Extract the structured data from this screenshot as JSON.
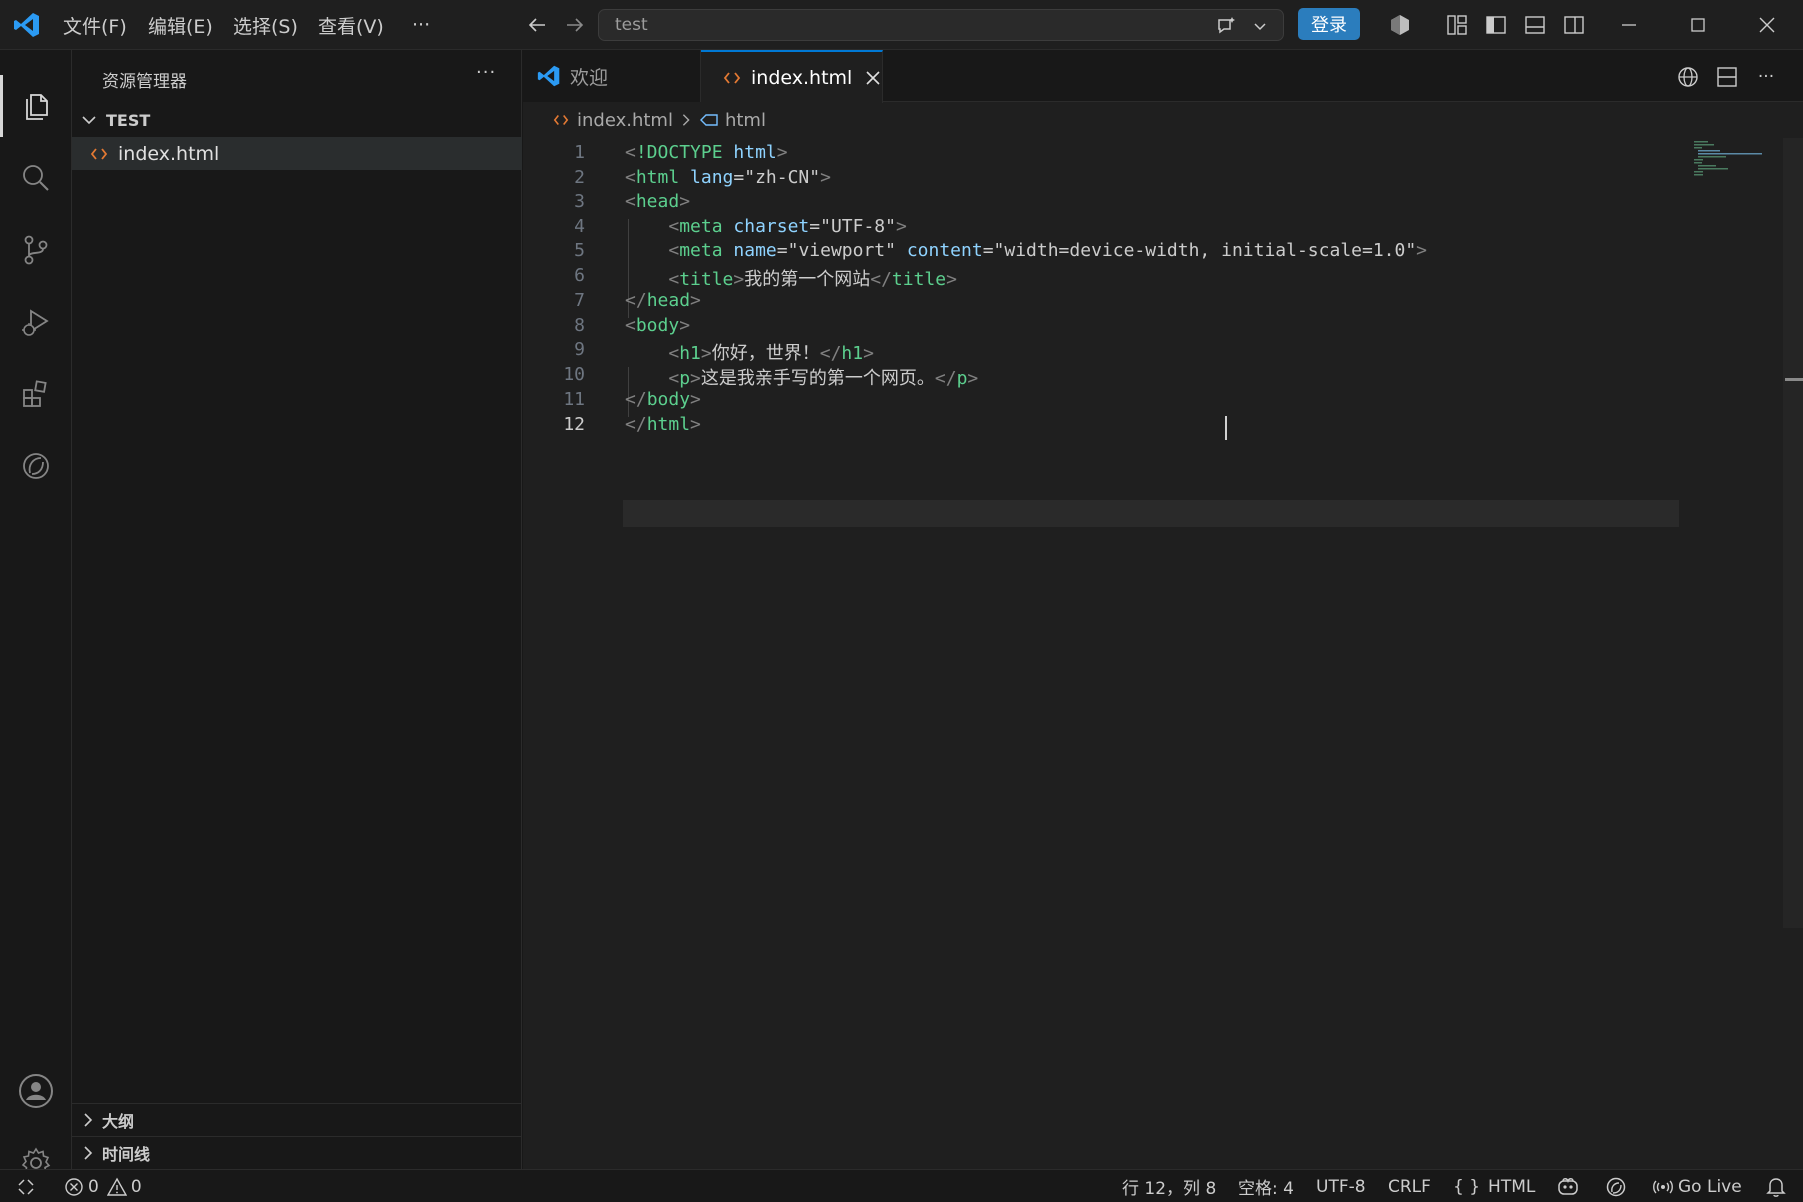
{
  "titlebar": {
    "menus": [
      "文件(F)",
      "编辑(E)",
      "选择(S)",
      "查看(V)"
    ],
    "more": "···",
    "search_text": "test",
    "login_label": "登录"
  },
  "activitybar": {
    "items": [
      "explorer",
      "search",
      "source-control",
      "run-debug",
      "extensions",
      "remote"
    ]
  },
  "sidebar": {
    "title": "资源管理器",
    "more": "···",
    "folder": "TEST",
    "files": [
      "index.html"
    ],
    "sections": [
      "大纲",
      "时间线"
    ]
  },
  "editor": {
    "tabs": [
      {
        "label": "欢迎",
        "active": false
      },
      {
        "label": "index.html",
        "active": true
      }
    ],
    "breadcrumb": {
      "file": "index.html",
      "symbol": "html"
    },
    "current_line": 12
  },
  "code_lines": [
    {
      "n": "1"
    },
    {
      "n": "2"
    },
    {
      "n": "3"
    },
    {
      "n": "4"
    },
    {
      "n": "5"
    },
    {
      "n": "6"
    },
    {
      "n": "7"
    },
    {
      "n": "8"
    },
    {
      "n": "9"
    },
    {
      "n": "10"
    },
    {
      "n": "11"
    },
    {
      "n": "12"
    }
  ],
  "code_text": {
    "doctype_kw": "!DOCTYPE",
    "doctype_val": "html",
    "html_tag": "html",
    "lang_attr": "lang",
    "lang_val": "\"zh-CN\"",
    "head_tag": "head",
    "meta_tag": "meta",
    "charset_attr": "charset",
    "charset_val": "\"UTF-8\"",
    "name_attr": "name",
    "name_val": "\"viewport\"",
    "content_attr": "content",
    "content_val": "\"width=device-width, initial-scale=1.0\"",
    "title_tag": "title",
    "title_text": "我的第一个网站",
    "body_tag": "body",
    "h1_tag": "h1",
    "h1_text": "你好，世界！",
    "p_tag": "p",
    "p_text": "这是我亲手写的第一个网页。"
  },
  "statusbar": {
    "errors": "0",
    "warnings": "0",
    "position": "行 12，列 8",
    "spaces": "空格: 4",
    "encoding": "UTF-8",
    "eol": "CRLF",
    "language_braces": "{ }",
    "language": "HTML",
    "go_live": "Go Live"
  },
  "colors": {
    "accent": "#0078d4",
    "login_button": "#2b7dbd",
    "tag": "#5ccf8e",
    "attribute": "#8fd3ff",
    "html_icon": "#e37933"
  }
}
